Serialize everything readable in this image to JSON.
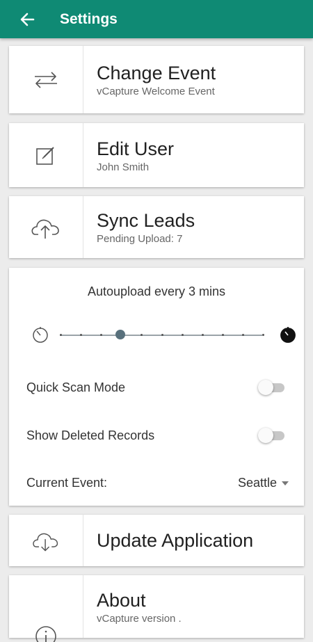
{
  "appbar": {
    "title": "Settings",
    "back_icon": "arrow-back-icon"
  },
  "cards": {
    "change_event": {
      "title": "Change Event",
      "subtitle": "vCapture Welcome Event",
      "icon": "swap-arrows-icon"
    },
    "edit_user": {
      "title": "Edit User",
      "subtitle": "John Smith",
      "icon": "edit-icon"
    },
    "sync_leads": {
      "title": "Sync Leads",
      "subtitle": "Pending Upload: 7",
      "icon": "cloud-upload-icon"
    },
    "update_app": {
      "title": "Update Application",
      "icon": "cloud-download-icon"
    },
    "about": {
      "title": "About",
      "subtitle": "vCapture version .",
      "icon": "info-icon"
    }
  },
  "settings": {
    "autoupload_label": "Autoupload every 3 mins",
    "slider": {
      "min_icon": "timer-empty-icon",
      "max_icon": "timer-full-icon",
      "steps": 11,
      "selected_step": 3
    },
    "quick_scan": {
      "label": "Quick Scan Mode",
      "enabled": false
    },
    "show_deleted": {
      "label": "Show Deleted Records",
      "enabled": false
    },
    "current_event": {
      "label": "Current Event:",
      "value": "Seattle"
    }
  },
  "colors": {
    "appbar": "#0f8a74",
    "background": "#ececec",
    "slider_thumb": "#58707c"
  }
}
